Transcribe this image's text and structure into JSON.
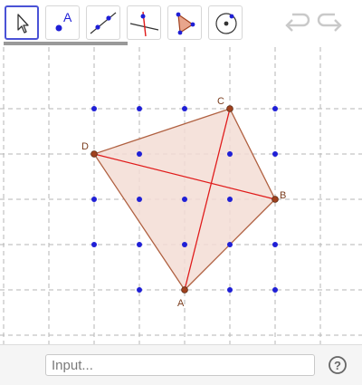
{
  "toolbar": {
    "tools": [
      {
        "name": "move-tool",
        "icon": "move-arrow-icon",
        "selected": true
      },
      {
        "name": "point-tool",
        "icon": "point-icon",
        "label": "A"
      },
      {
        "name": "line-tool",
        "icon": "line-through-points-icon"
      },
      {
        "name": "perpendicular-line-tool",
        "icon": "perpendicular-line-icon"
      },
      {
        "name": "polygon-tool",
        "icon": "polygon-icon"
      },
      {
        "name": "circle-tool",
        "icon": "circle-with-center-icon"
      }
    ],
    "undo_icon": "undo-icon",
    "redo_icon": "redo-icon"
  },
  "canvas": {
    "grid": true,
    "grid_x_range": [
      -2,
      5
    ],
    "grid_y_range": [
      -1,
      5
    ],
    "lattice_points": [
      [
        1,
        1
      ],
      [
        2,
        1
      ],
      [
        3,
        1
      ],
      [
        4,
        1
      ],
      [
        0,
        2
      ],
      [
        1,
        2
      ],
      [
        2,
        2
      ],
      [
        3,
        2
      ],
      [
        4,
        2
      ],
      [
        0,
        3
      ],
      [
        1,
        3
      ],
      [
        2,
        3
      ],
      [
        3,
        3
      ],
      [
        4,
        3
      ],
      [
        0,
        4
      ],
      [
        1,
        4
      ],
      [
        3,
        4
      ],
      [
        4,
        4
      ],
      [
        0,
        5
      ],
      [
        1,
        5
      ],
      [
        2,
        5
      ],
      [
        4,
        5
      ]
    ],
    "points": {
      "A": {
        "label": "A",
        "coords": [
          2,
          1
        ]
      },
      "B": {
        "label": "B",
        "coords": [
          4,
          3
        ]
      },
      "C": {
        "label": "C",
        "coords": [
          3,
          5
        ]
      },
      "D": {
        "label": "D",
        "coords": [
          0,
          4
        ]
      }
    },
    "polygon": [
      "A",
      "B",
      "C",
      "D"
    ],
    "diagonals": [
      [
        "A",
        "C"
      ],
      [
        "B",
        "D"
      ]
    ],
    "colors": {
      "lattice_point": "#1f1fd6",
      "vertex": "#a0411e",
      "polygon_fill": "#f3ddd5",
      "polygon_edge": "#b06040",
      "diagonal": "#e01a1a",
      "label": "#7a3d1e",
      "grid": "#b5b5b5"
    }
  },
  "input_bar": {
    "placeholder": "Input..."
  },
  "help": {
    "icon": "help-icon",
    "label": "?"
  }
}
